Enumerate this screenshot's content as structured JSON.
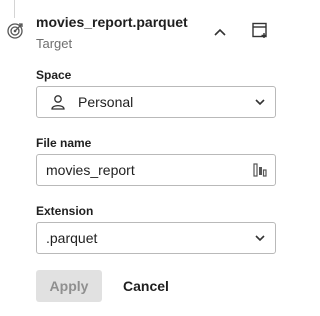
{
  "header": {
    "title": "movies_report.parquet",
    "subtitle": "Target",
    "node_icon": "target-node-icon",
    "collapse_icon": "chevron-up-icon",
    "new_window_icon": "open-in-new-window-icon"
  },
  "form": {
    "space": {
      "label": "Space",
      "value": "Personal",
      "icon": "person-icon"
    },
    "file_name": {
      "label": "File name",
      "value": "movies_report",
      "icon": "variable-icon"
    },
    "extension": {
      "label": "Extension",
      "value": ".parquet"
    }
  },
  "actions": {
    "apply_label": "Apply",
    "apply_enabled": false,
    "cancel_label": "Cancel"
  },
  "colors": {
    "border": "#b9b9b9",
    "text": "#1f1f1f",
    "muted": "#6f6f6f",
    "disabled_bg": "#e1e1e1",
    "disabled_text": "#8f8f8f"
  }
}
